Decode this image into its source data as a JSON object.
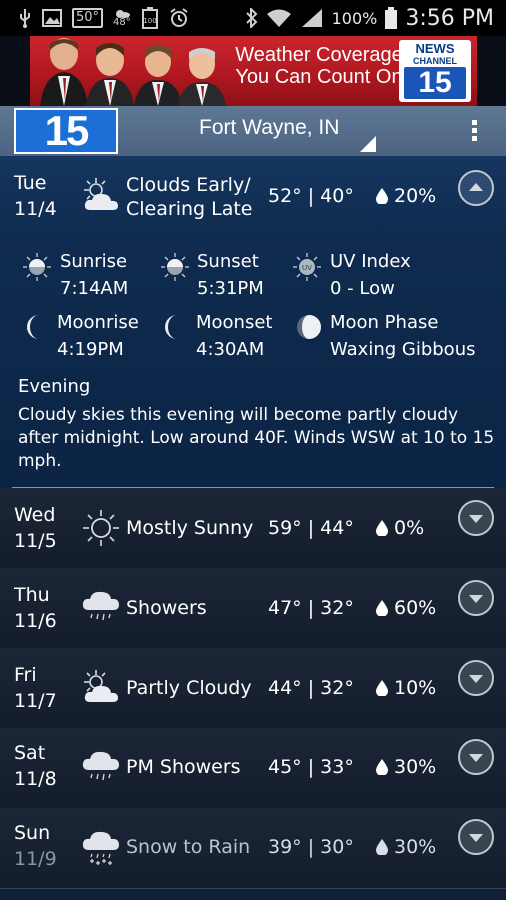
{
  "status_bar": {
    "temp_badge": "50°",
    "temp_small": "48°",
    "battery_badge": "100",
    "battery_pct": "100%",
    "time": "3:56 PM"
  },
  "ad": {
    "headline_line1": "Weather Coverage",
    "headline_line2": "You Can Count On",
    "logo_news": "NEWS",
    "logo_channel": "CHANNEL",
    "logo_number": "15"
  },
  "header": {
    "logo": "15",
    "location": "Fort Wayne, IN"
  },
  "today": {
    "day": "Tue",
    "date": "11/4",
    "condition_line1": "Clouds Early/",
    "condition_line2": "Clearing Late",
    "temps": "52° | 40°",
    "precip": "20%",
    "icon": "partly-cloudy-icon",
    "details": {
      "sunrise_label": "Sunrise",
      "sunrise_value": "7:14AM",
      "sunset_label": "Sunset",
      "sunset_value": "5:31PM",
      "uv_label": "UV Index",
      "uv_value": "0 - Low",
      "moonrise_label": "Moonrise",
      "moonrise_value": "4:19PM",
      "moonset_label": "Moonset",
      "moonset_value": "4:30AM",
      "moonphase_label": "Moon Phase",
      "moonphase_value": "Waxing Gibbous"
    },
    "evening_title": "Evening",
    "evening_text": "Cloudy skies this evening will become partly cloudy after midnight. Low around 40F. Winds WSW at 10 to 15 mph."
  },
  "days": [
    {
      "day": "Wed",
      "date": "11/5",
      "condition": "Mostly Sunny",
      "temps": "59° | 44°",
      "precip": "0%",
      "icon": "sun-icon"
    },
    {
      "day": "Thu",
      "date": "11/6",
      "condition": "Showers",
      "temps": "47° | 32°",
      "precip": "60%",
      "icon": "rain-cloud-icon"
    },
    {
      "day": "Fri",
      "date": "11/7",
      "condition": "Partly Cloudy",
      "temps": "44° | 32°",
      "precip": "10%",
      "icon": "partly-cloudy-icon"
    },
    {
      "day": "Sat",
      "date": "11/8",
      "condition": "PM Showers",
      "temps": "45° | 33°",
      "precip": "30%",
      "icon": "rain-cloud-icon"
    },
    {
      "day": "Sun",
      "date": "11/9",
      "condition": "Snow to Rain",
      "temps": "39° | 30°",
      "precip": "30%",
      "icon": "snow-rain-icon"
    }
  ]
}
